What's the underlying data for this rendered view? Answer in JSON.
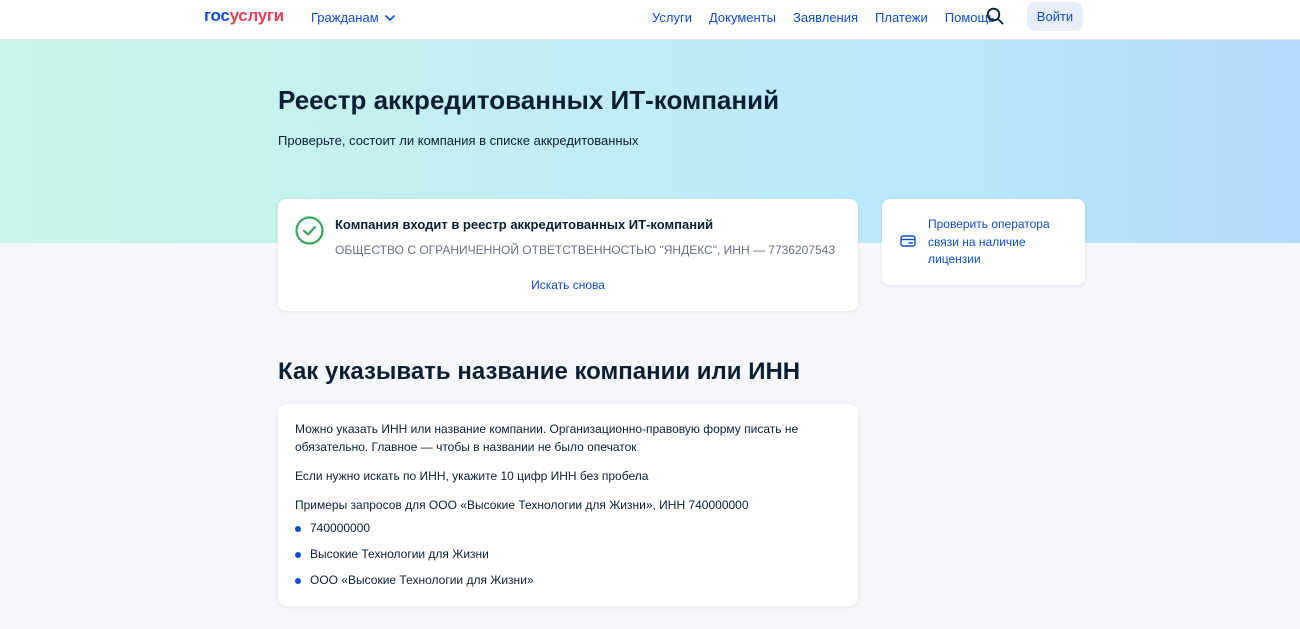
{
  "header": {
    "logo_gos": "гос",
    "logo_uslugi": "услуги",
    "citizens": "Гражданам",
    "nav": [
      "Услуги",
      "Документы",
      "Заявления",
      "Платежи",
      "Помощь"
    ],
    "login": "Войти"
  },
  "hero": {
    "title": "Реестр аккредитованных ИТ-компаний",
    "subtitle": "Проверьте, состоит ли компания в списке аккредитованных"
  },
  "result": {
    "title": "Компания входит в реестр аккредитованных ИТ-компаний",
    "company": "ОБЩЕСТВО С ОГРАНИЧЕННОЙ ОТВЕТСТВЕННОСТЬЮ \"ЯНДЕКС\", ИНН — 7736207543",
    "search_again": "Искать снова"
  },
  "side": {
    "link": "Проверить оператора связи на наличие лицензии"
  },
  "howto": {
    "title": "Как указывать название компании или ИНН",
    "p1": "Можно указать ИНН или название компании. Организационно-правовую форму писать не обязательно. Главное — чтобы в названии не было опечаток",
    "p2": "Если нужно искать по ИНН, укажите 10 цифр ИНН без пробела",
    "p3": "Примеры запросов для ООО «Высокие Технологии для Жизни», ИНН 740000000",
    "examples": [
      "740000000",
      "Высокие Технологии для Жизни",
      "ООО «Высокие Технологии для Жизни»"
    ]
  },
  "colors": {
    "accent": "#0d4cd3",
    "success": "#3aa55b",
    "logo_red": "#ee3f58"
  },
  "icons": {
    "chevron": "chevron-down-icon",
    "search": "search-icon",
    "check": "check-circle-icon",
    "card": "card-icon"
  }
}
